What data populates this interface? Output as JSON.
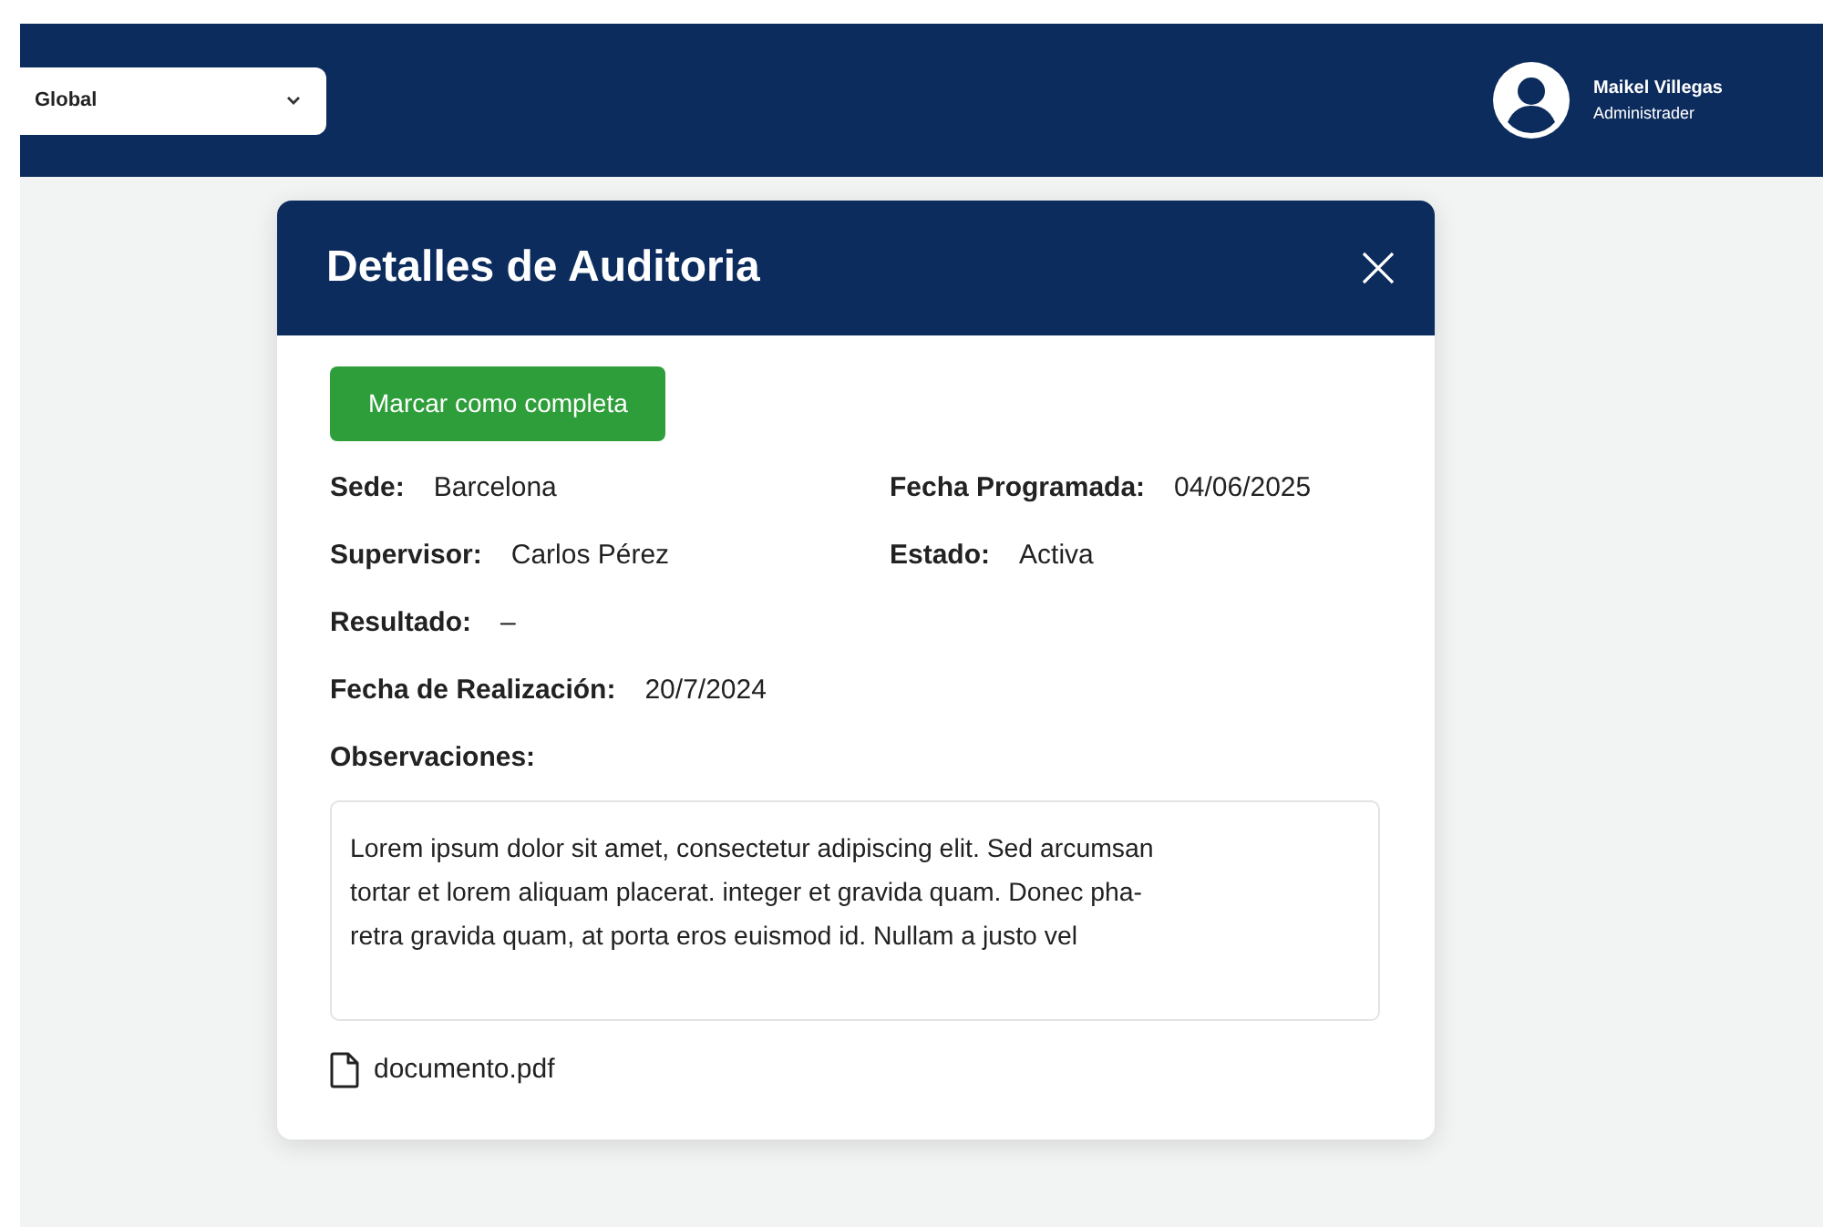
{
  "topbar": {
    "scope_select": {
      "value": "Global"
    },
    "user": {
      "name": "Maikel Villegas",
      "role": "Administrader"
    }
  },
  "modal": {
    "title": "Detalles de Auditoria",
    "primary_action": "Marcar como completa",
    "detail_rows": [
      [
        {
          "label": "Sede:",
          "value": "Barcelona"
        },
        {
          "label": "Fecha Programada:",
          "value": "04/06/2025"
        }
      ],
      [
        {
          "label": "Supervisor:",
          "value": "Carlos Pérez"
        },
        {
          "label": "Estado:",
          "value": "Activa"
        }
      ],
      [
        {
          "label": "Resultado:",
          "value": "–"
        }
      ],
      [
        {
          "label": "Fecha de Realización:",
          "value": "20/7/2024"
        }
      ]
    ],
    "observations_label": "Observaciones:",
    "observations_lines": [
      "Lorem ipsum dolor sit amet, consectetur adipiscing elit.  Sed arcumsan",
      "tortar et lorem aliquam placerat. integer et gravida quam. Donec pha-",
      "retra gravida quam, at porta eros euismod id. Nullam a justo vel"
    ],
    "attachment": "documento.pdf"
  }
}
